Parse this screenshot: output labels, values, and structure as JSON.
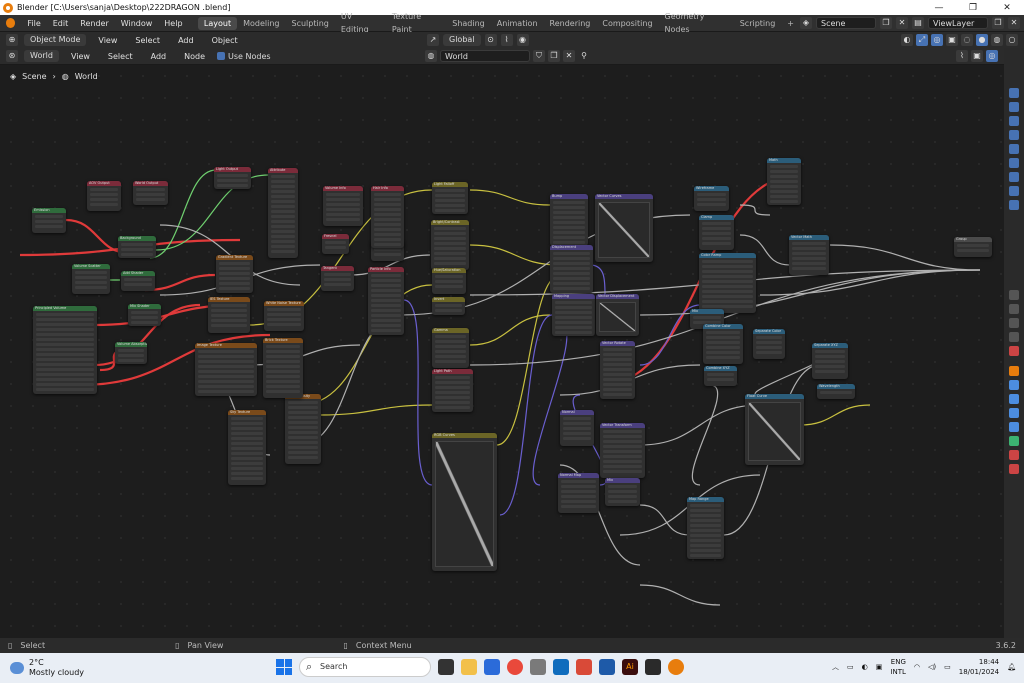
{
  "window": {
    "title": "Blender [C:\\Users\\sanja\\Desktop\\222DRAGON .blend]",
    "controls": [
      "—",
      "❐",
      "✕"
    ]
  },
  "menubar": {
    "items": [
      "File",
      "Edit",
      "Render",
      "Window",
      "Help"
    ],
    "workspaces": [
      "Layout",
      "Modeling",
      "Sculpting",
      "UV Editing",
      "Texture Paint",
      "Shading",
      "Animation",
      "Rendering",
      "Compositing",
      "Geometry Nodes",
      "Scripting"
    ],
    "active_workspace": "Layout",
    "add_workspace": "+",
    "scene": "Scene",
    "view_layer": "ViewLayer"
  },
  "toolbar1": {
    "mode": "Object Mode",
    "items": [
      "View",
      "Select",
      "Add",
      "Object"
    ],
    "transform": "Global"
  },
  "toolbar2": {
    "shader_type": "World",
    "items": [
      "View",
      "Select",
      "Add",
      "Node"
    ],
    "use_nodes_label": "Use Nodes",
    "world_name": "World"
  },
  "breadcrumb": {
    "scene": "Scene",
    "world": "World"
  },
  "statusbar": {
    "select": "Select",
    "pan": "Pan View",
    "context": "Context Menu",
    "version": "3.6.2"
  },
  "taskbar": {
    "weather_temp": "2°C",
    "weather_desc": "Mostly cloudy",
    "search_placeholder": "Search",
    "lang": "ENG",
    "layout": "INTL",
    "time": "18:44",
    "date": "18/01/2024"
  },
  "colors": {
    "orange": "#e87d0d",
    "node_green": "#2f6b3c",
    "node_red": "#7b2b3a",
    "node_purple": "#4a3f7e",
    "node_yellow": "#6b6526",
    "node_orange": "#7a4a1a",
    "node_blue": "#2b5d7a",
    "node_gray": "#4a4a4a",
    "wire_red": "#e03a3a",
    "wire_yellow": "#c8c040",
    "wire_purple": "#6a5fd0",
    "wire_gray": "#b0b0b0",
    "wire_green": "#6fcf6f"
  },
  "nodes": [
    {
      "title": "Emission",
      "color": "node_green"
    },
    {
      "title": "AOV Output",
      "color": "node_red"
    },
    {
      "title": "World Output",
      "color": "node_red"
    },
    {
      "title": "Light Output",
      "color": "node_red"
    },
    {
      "title": "Background",
      "color": "node_green"
    },
    {
      "title": "Volume Scatter",
      "color": "node_green"
    },
    {
      "title": "Add Shader",
      "color": "node_green"
    },
    {
      "title": "Mix Shader",
      "color": "node_green"
    },
    {
      "title": "Principled Volume",
      "color": "node_green"
    },
    {
      "title": "Volume Absorption",
      "color": "node_green"
    },
    {
      "title": "Gradient Texture",
      "color": "node_orange"
    },
    {
      "title": "IES Texture",
      "color": "node_orange"
    },
    {
      "title": "Image Texture",
      "color": "node_orange"
    },
    {
      "title": "Sky Texture",
      "color": "node_orange"
    },
    {
      "title": "Point Density",
      "color": "node_orange"
    },
    {
      "title": "White Noise Texture",
      "color": "node_orange"
    },
    {
      "title": "Brick Texture",
      "color": "node_orange"
    },
    {
      "title": "Attribute",
      "color": "node_red"
    },
    {
      "title": "Fresnel",
      "color": "node_red"
    },
    {
      "title": "Tangent",
      "color": "node_red"
    },
    {
      "title": "Object Info",
      "color": "node_red"
    },
    {
      "title": "Particle Info",
      "color": "node_red"
    },
    {
      "title": "Hair Info",
      "color": "node_red"
    },
    {
      "title": "Volume Info",
      "color": "node_red"
    },
    {
      "title": "Light Falloff",
      "color": "node_yellow"
    },
    {
      "title": "Bright/Contrast",
      "color": "node_yellow"
    },
    {
      "title": "Hue/Saturation",
      "color": "node_yellow"
    },
    {
      "title": "Invert",
      "color": "node_yellow"
    },
    {
      "title": "Gamma",
      "color": "node_yellow"
    },
    {
      "title": "Light Path",
      "color": "node_red"
    },
    {
      "title": "RGB Curves",
      "color": "node_yellow"
    },
    {
      "title": "Bump",
      "color": "node_purple"
    },
    {
      "title": "Vector Curves",
      "color": "node_purple"
    },
    {
      "title": "Displacement",
      "color": "node_purple"
    },
    {
      "title": "Mapping",
      "color": "node_purple"
    },
    {
      "title": "Vector Displacement",
      "color": "node_purple"
    },
    {
      "title": "Vector Rotate",
      "color": "node_purple"
    },
    {
      "title": "Normal",
      "color": "node_purple"
    },
    {
      "title": "Vector Transform",
      "color": "node_purple"
    },
    {
      "title": "Normal Map",
      "color": "node_purple"
    },
    {
      "title": "Mix",
      "color": "node_purple"
    },
    {
      "title": "Wireframe",
      "color": "node_blue"
    },
    {
      "title": "Clamp",
      "color": "node_blue"
    },
    {
      "title": "Color Ramp",
      "color": "node_blue"
    },
    {
      "title": "Mix",
      "color": "node_blue"
    },
    {
      "title": "Combine Color",
      "color": "node_blue"
    },
    {
      "title": "Combine XYZ",
      "color": "node_blue"
    },
    {
      "title": "Separate Color",
      "color": "node_blue"
    },
    {
      "title": "Separate XYZ",
      "color": "node_blue"
    },
    {
      "title": "Float Curve",
      "color": "node_blue"
    },
    {
      "title": "Wavelength",
      "color": "node_blue"
    },
    {
      "title": "Map Range",
      "color": "node_blue"
    },
    {
      "title": "Math",
      "color": "node_blue"
    },
    {
      "title": "Vector Math",
      "color": "node_blue"
    },
    {
      "title": "Group",
      "color": "node_gray"
    }
  ]
}
